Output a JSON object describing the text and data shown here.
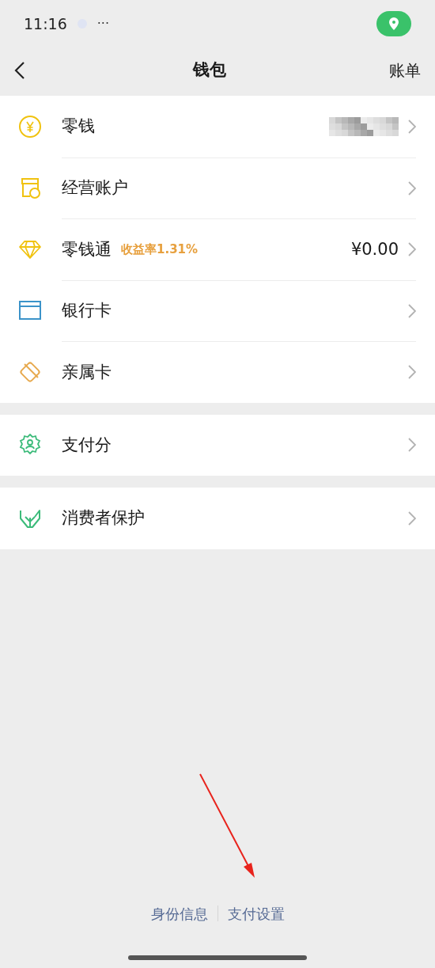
{
  "status_bar": {
    "time": "11:16",
    "more": "···"
  },
  "nav": {
    "title": "钱包",
    "action": "账单"
  },
  "groups": [
    {
      "items": [
        {
          "kind": "coin",
          "label": "零钱",
          "value_hidden": true
        },
        {
          "kind": "shop",
          "label": "经营账户"
        },
        {
          "kind": "diamond",
          "label": "零钱通",
          "tag": "收益率1.31%",
          "value": "¥0.00"
        },
        {
          "kind": "bankcard",
          "label": "银行卡"
        },
        {
          "kind": "familycard",
          "label": "亲属卡"
        }
      ]
    },
    {
      "items": [
        {
          "kind": "score",
          "label": "支付分"
        }
      ]
    },
    {
      "items": [
        {
          "kind": "protect",
          "label": "消费者保护"
        }
      ]
    }
  ],
  "footer_links": [
    "身份信息",
    "支付设置"
  ]
}
